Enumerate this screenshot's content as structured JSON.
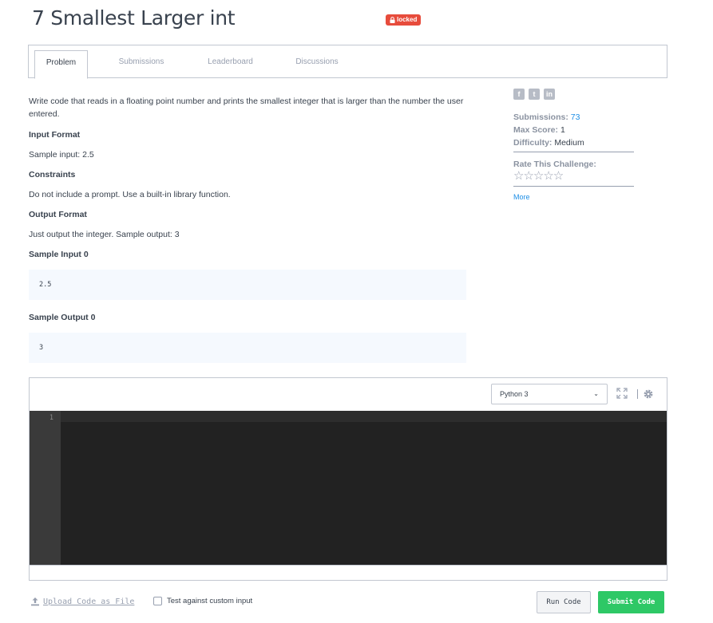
{
  "challenge": {
    "title": "7 Smallest Larger int",
    "badge": "locked"
  },
  "tabs": [
    {
      "label": "Problem",
      "active": true
    },
    {
      "label": "Submissions",
      "active": false
    },
    {
      "label": "Leaderboard",
      "active": false
    },
    {
      "label": "Discussions",
      "active": false
    }
  ],
  "problem": {
    "description": "Write code that reads in a floating point number and prints the smallest integer that is larger than the number the user entered.",
    "input_format_heading": "Input Format",
    "input_format_text": "Sample input: 2.5",
    "constraints_heading": "Constraints",
    "constraints_text": "Do not include a prompt. Use a built-in library function.",
    "output_format_heading": "Output Format",
    "output_format_text": "Just output the integer. Sample output: 3",
    "sample_input_heading": "Sample Input 0",
    "sample_input_value": "2.5",
    "sample_output_heading": "Sample Output 0",
    "sample_output_value": "3"
  },
  "sidebar": {
    "social": [
      "f",
      "t",
      "in"
    ],
    "submissions_label": "Submissions:",
    "submissions_value": "73",
    "max_score_label": "Max Score:",
    "max_score_value": "1",
    "difficulty_label": "Difficulty:",
    "difficulty_value": "Medium",
    "rate_label": "Rate This Challenge:",
    "stars": "☆☆☆☆☆",
    "more_label": "More"
  },
  "editor": {
    "language": "Python 3",
    "line_numbers": [
      "1"
    ]
  },
  "footer": {
    "upload_label": "Upload Code as File",
    "custom_input_label": "Test against custom input",
    "run_label": "Run Code",
    "submit_label": "Submit Code"
  },
  "colors": {
    "badge": "#e74c3c",
    "submit": "#2ec866",
    "link": "#1d8ee6",
    "editor_bg": "#272727"
  }
}
